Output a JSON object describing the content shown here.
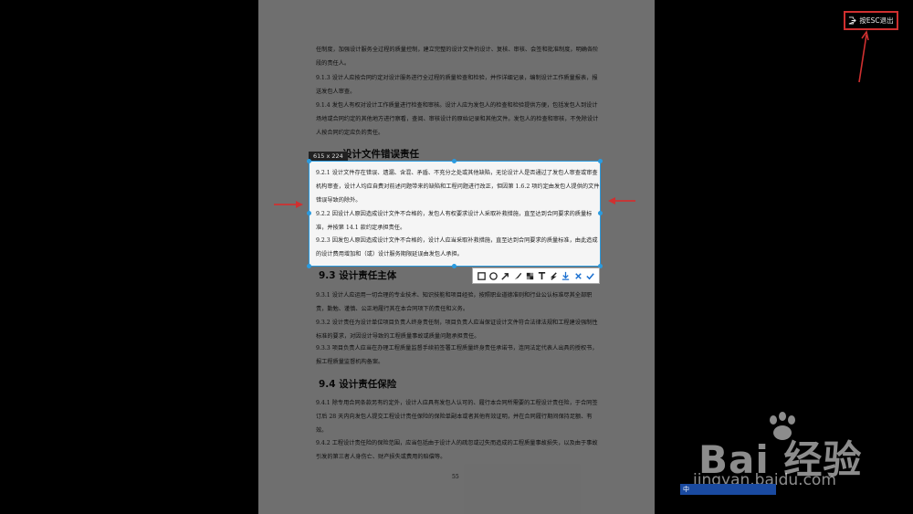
{
  "exit_button": {
    "label": "按ESC退出",
    "icon": "exit-icon"
  },
  "selection": {
    "size_label": "615 x 224"
  },
  "toolbar": {
    "tools": [
      {
        "name": "rectangle-tool",
        "icon": "rectangle-icon"
      },
      {
        "name": "ellipse-tool",
        "icon": "circle-icon"
      },
      {
        "name": "arrow-tool",
        "icon": "arrow-icon"
      },
      {
        "name": "brush-tool",
        "icon": "brush-icon"
      },
      {
        "name": "mosaic-tool",
        "icon": "mosaic-icon"
      },
      {
        "name": "text-tool",
        "icon": "text-icon"
      },
      {
        "name": "undo-tool",
        "icon": "undo-icon"
      },
      {
        "name": "save-tool",
        "icon": "download-icon"
      },
      {
        "name": "cancel-tool",
        "icon": "close-icon"
      },
      {
        "name": "confirm-tool",
        "icon": "check-icon"
      }
    ]
  },
  "document": {
    "paragraphs": [
      "任制度，加强设计服务全过程的质量控制，建立完整的设计文件的设计、复核、审核、会签和批准制度，明确各阶段的责任人。",
      "9.1.3 设计人应按合同约定对设计服务进行全过程的质量检查和检验，并作详细记录，编制设计工作质量报表，报送发包人审查。",
      "9.1.4 发包人有权对设计工作质量进行检查和审核。设计人应为发包人的检查和检验提供方便，包括发包人到设计场地或合同约定的其他地方进行察看，查阅、审核设计的原始记录和其他文件。发包人的检查和审核，不免除设计人按合同约定应负的责任。",
      "9.2.1 设计文件存在错误、遗漏、含混、矛盾、不充分之处或其他缺陷，无论设计人是否通过了发包人审查或审查机构审查，设计人均应自费对前述问题带来的缺陷和工程问题进行改正，但因第 1.6.2 项约定由发包人提供的文件错误导致的除外。",
      "9.2.2 因设计人原因造成设计文件不合格的，发包人有权要求设计人采取补救措施，直至达到合同要求的质量标准，并按第 14.1 款约定承担责任。",
      "9.2.3 因发包人原因造成设计文件不合格的，设计人应当采取补救措施，直至达到合同要求的质量标准，由此造成的设计费用增加和（或）设计服务期限延误由发包人承担。",
      "9.3.1 设计人应运用一切合理的专业技术、知识技能和项目经验，按照职业道德准则和行业公认标准尽其全部职责，勤勉、谨慎、公正地履行其在本合同项下的责任和义务。",
      "9.3.2 设计责任为设计单位项目负责人终身责任制，项目负责人应当保证设计文件符合法律法规和工程建设强制性标准的要求，对因设计导致的工程质量事故或质量问题承担责任。",
      "9.3.3 项目负责人应当在办理工程质量监督手续前签署工程质量终身责任承诺书，连同法定代表人出具的授权书，报工程质量监督机构备案。",
      "9.4.1 除专用合同条款另有约定外，设计人应具有发包人认可的、履行本合同所需要的工程设计责任险，于合同签订后 28 天内向发包人提交工程设计责任保险的保险单副本或者其他有效证明，并在合同履行期间保持足额、有效。",
      "9.4.2 工程设计责任险的保险范围，应当包括由于设计人的疏忽或过失而造成的工程质量事故损失，以及由于事故引发的第三者人身伤亡、财产损失或费用的赔偿等。"
    ],
    "headings": [
      "设计文件错误责任",
      "9.3 设计责任主体",
      "9.4 设计责任保险"
    ],
    "page_number": "55"
  },
  "watermark": {
    "text": "Bai 经验",
    "url": "jingyan.baidu.com"
  },
  "bottom_badge": "中"
}
